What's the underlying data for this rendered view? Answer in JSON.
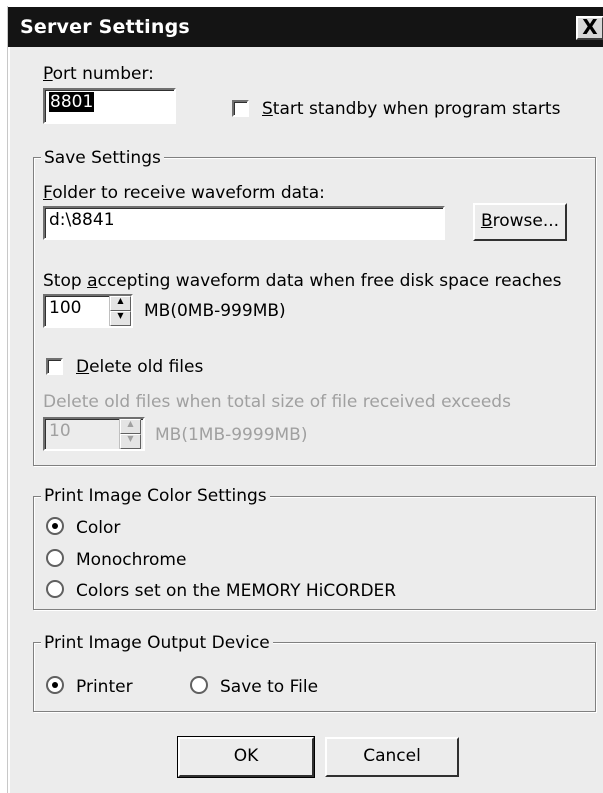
{
  "window": {
    "title": "Server Settings",
    "close_glyph": "X"
  },
  "port": {
    "label_u": "P",
    "label_rest": "ort number:",
    "value": "8801"
  },
  "standby": {
    "label_u": "S",
    "label_rest": "tart standby when program starts",
    "checked": false
  },
  "save_settings": {
    "title": "Save Settings",
    "folder_label_u": "F",
    "folder_label_rest": "older to receive waveform data:",
    "folder_value": "d:\\8841",
    "browse_u": "B",
    "browse_rest": "rowse...",
    "stop_label_pre": "Stop ",
    "stop_label_u": "a",
    "stop_label_rest": "ccepting waveform data when free disk space reaches",
    "stop_value": "100",
    "stop_unit": "MB(0MB-999MB)",
    "delete_u": "D",
    "delete_rest": "elete old files",
    "delete_checked": false,
    "delete_when_label": "Delete old files when total size of file received exceeds",
    "delete_when_value": "10",
    "delete_when_unit": "MB(1MB-9999MB)"
  },
  "color_settings": {
    "title": "Print Image Color Settings",
    "options": [
      "Color",
      "Monochrome",
      "Colors set on the MEMORY HiCORDER"
    ],
    "selected": "Color"
  },
  "output_device": {
    "title": "Print Image Output Device",
    "options": [
      "Printer",
      "Save to File"
    ],
    "selected": "Printer"
  },
  "buttons": {
    "ok": "OK",
    "cancel": "Cancel"
  }
}
